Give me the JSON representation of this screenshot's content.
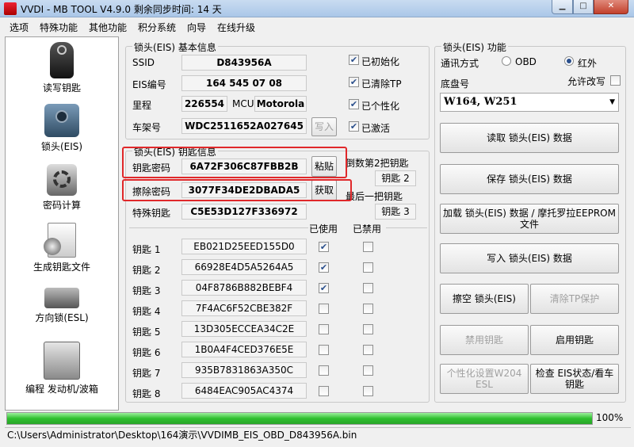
{
  "window": {
    "title": "VVDI - MB TOOL V4.9.0   剩余同步时间: 14 天"
  },
  "menu": [
    "选项",
    "特殊功能",
    "其他功能",
    "积分系统",
    "向导",
    "在线升级"
  ],
  "sidebar": [
    {
      "label": "读写钥匙",
      "icon": "key-fob-icon"
    },
    {
      "label": "锁头(EIS)",
      "icon": "eis-module-icon"
    },
    {
      "label": "密码计算",
      "icon": "password-calc-icon"
    },
    {
      "label": "生成钥匙文件",
      "icon": "key-file-icon"
    },
    {
      "label": "方向锁(ESL)",
      "icon": "esl-icon"
    },
    {
      "label": "编程 发动机/波箱",
      "icon": "ecu-icon"
    }
  ],
  "basic": {
    "title": "锁头(EIS) 基本信息",
    "ssid_label": "SSID",
    "ssid": "D843956A",
    "eis_no_label": "EIS编号",
    "eis_no": "164 545 07 08",
    "mileage_label": "里程",
    "mileage": "226554",
    "mcu_label": "MCU",
    "mcu": "Motorola",
    "vin_label": "车架号",
    "vin": "WDC2511652A027645",
    "write_btn": "写入",
    "flags": [
      {
        "label": "已初始化",
        "checked": true
      },
      {
        "label": "已清除TP",
        "checked": true
      },
      {
        "label": "已个性化",
        "checked": true
      },
      {
        "label": "已激活",
        "checked": true
      }
    ]
  },
  "keys": {
    "title": "锁头(EIS) 钥匙信息",
    "key_pw_label": "钥匙密码",
    "key_pw": "6A72F306C87FBB2B",
    "paste_btn": "粘贴",
    "erase_pw_label": "擦除密码",
    "erase_pw": "3077F34DE2DBADA5",
    "get_btn": "获取",
    "special_label": "特殊钥匙",
    "special": "C5E53D127F336972",
    "penultimate_label": "倒数第2把钥匙",
    "penultimate": "钥匙 2",
    "last_label": "最后一把钥匙",
    "last": "钥匙 3",
    "used_header": "已使用",
    "disabled_header": "已禁用",
    "rows": [
      {
        "label": "钥匙 1",
        "value": "EB021D25EED155D0",
        "used": true,
        "disabled": false
      },
      {
        "label": "钥匙 2",
        "value": "66928E4D5A5264A5",
        "used": true,
        "disabled": false
      },
      {
        "label": "钥匙 3",
        "value": "04F8786B882BEBF4",
        "used": true,
        "disabled": false
      },
      {
        "label": "钥匙 4",
        "value": "7F4AC6F52CBE382F",
        "used": false,
        "disabled": false
      },
      {
        "label": "钥匙 5",
        "value": "13D305ECCEA34C2E",
        "used": false,
        "disabled": false
      },
      {
        "label": "钥匙 6",
        "value": "1B0A4F4CED376E5E",
        "used": false,
        "disabled": false
      },
      {
        "label": "钥匙 7",
        "value": "935B7831863A350C",
        "used": false,
        "disabled": false
      },
      {
        "label": "钥匙 8",
        "value": "6484EAC905AC4374",
        "used": false,
        "disabled": false
      }
    ]
  },
  "func": {
    "title": "锁头(EIS) 功能",
    "comm_label": "通讯方式",
    "obd_label": "OBD",
    "ir_label": "红外",
    "comm_selected": "红外",
    "chassis_label": "底盘号",
    "allow_edit_label": "允许改写",
    "chassis_value": "W164, W251",
    "buttons": {
      "read": "读取 锁头(EIS) 数据",
      "save": "保存 锁头(EIS) 数据",
      "load": "加载 锁头(EIS) 数据 / 摩托罗拉EEPROM 文件",
      "write": "写入 锁头(EIS) 数据",
      "empty": "擦空 锁头(EIS)",
      "clear_tp": "清除TP保护",
      "disable_key": "禁用钥匙",
      "enable_key": "启用钥匙",
      "personalize": "个性化设置W204 ESL",
      "check": "检查 EIS状态/看车钥匙"
    }
  },
  "progress": {
    "value": 100,
    "label": "100%"
  },
  "status": {
    "path": "C:\\Users\\Administrator\\Desktop\\164演示\\VVDIMB_EIS_OBD_D843956A.bin"
  }
}
